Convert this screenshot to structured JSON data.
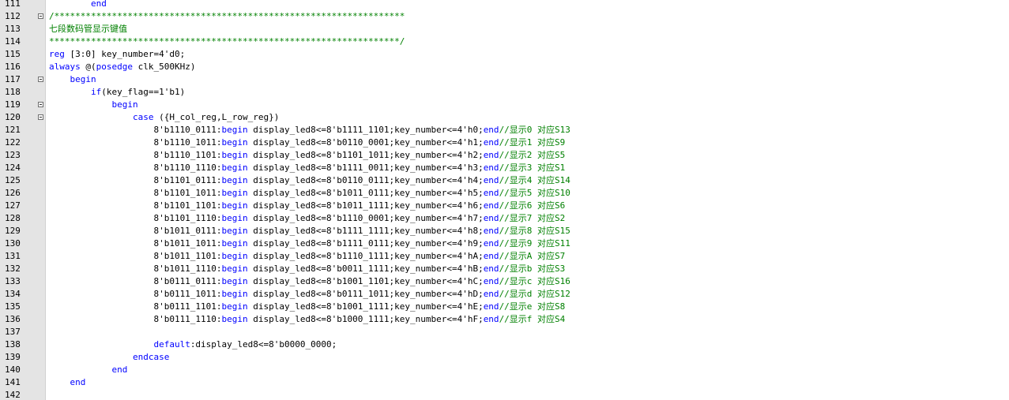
{
  "editor": {
    "lines": [
      {
        "num": "111",
        "fold": false,
        "tokens": [
          {
            "t": "        ",
            "c": ""
          },
          {
            "t": "end",
            "c": "kw"
          }
        ]
      },
      {
        "num": "112",
        "fold": true,
        "tokens": [
          {
            "t": "/*******************************************************************",
            "c": "cm"
          }
        ]
      },
      {
        "num": "113",
        "fold": false,
        "tokens": [
          {
            "t": "七段数码管显示键值",
            "c": "cm"
          }
        ]
      },
      {
        "num": "114",
        "fold": false,
        "tokens": [
          {
            "t": "*******************************************************************/",
            "c": "cm"
          }
        ]
      },
      {
        "num": "115",
        "fold": false,
        "tokens": [
          {
            "t": "reg",
            "c": "kw"
          },
          {
            "t": " [3:0] key_number=4'd0;",
            "c": ""
          }
        ]
      },
      {
        "num": "116",
        "fold": false,
        "tokens": [
          {
            "t": "always",
            "c": "kw"
          },
          {
            "t": " @(",
            "c": ""
          },
          {
            "t": "posedge",
            "c": "kw"
          },
          {
            "t": " clk_500KHz)",
            "c": ""
          }
        ]
      },
      {
        "num": "117",
        "fold": true,
        "tokens": [
          {
            "t": "    ",
            "c": ""
          },
          {
            "t": "begin",
            "c": "kw"
          }
        ]
      },
      {
        "num": "118",
        "fold": false,
        "tokens": [
          {
            "t": "        ",
            "c": ""
          },
          {
            "t": "if",
            "c": "kw"
          },
          {
            "t": "(key_flag==1'b1)",
            "c": ""
          }
        ]
      },
      {
        "num": "119",
        "fold": true,
        "tokens": [
          {
            "t": "            ",
            "c": ""
          },
          {
            "t": "begin",
            "c": "kw"
          }
        ]
      },
      {
        "num": "120",
        "fold": true,
        "tokens": [
          {
            "t": "                ",
            "c": ""
          },
          {
            "t": "case",
            "c": "kw"
          },
          {
            "t": " ({H_col_reg,L_row_reg})",
            "c": ""
          }
        ]
      },
      {
        "num": "121",
        "fold": false,
        "tokens": [
          {
            "t": "                    8'b1110_0111:",
            "c": ""
          },
          {
            "t": "begin",
            "c": "kw"
          },
          {
            "t": " display_led8<=8'b1111_1101;key_number<=4'h0;",
            "c": ""
          },
          {
            "t": "end",
            "c": "kw"
          },
          {
            "t": "//显示0 对应S13",
            "c": "cm"
          }
        ]
      },
      {
        "num": "122",
        "fold": false,
        "tokens": [
          {
            "t": "                    8'b1110_1011:",
            "c": ""
          },
          {
            "t": "begin",
            "c": "kw"
          },
          {
            "t": " display_led8<=8'b0110_0001;key_number<=4'h1;",
            "c": ""
          },
          {
            "t": "end",
            "c": "kw"
          },
          {
            "t": "//显示1 对应S9",
            "c": "cm"
          }
        ]
      },
      {
        "num": "123",
        "fold": false,
        "tokens": [
          {
            "t": "                    8'b1110_1101:",
            "c": ""
          },
          {
            "t": "begin",
            "c": "kw"
          },
          {
            "t": " display_led8<=8'b1101_1011;key_number<=4'h2;",
            "c": ""
          },
          {
            "t": "end",
            "c": "kw"
          },
          {
            "t": "//显示2 对应S5",
            "c": "cm"
          }
        ]
      },
      {
        "num": "124",
        "fold": false,
        "tokens": [
          {
            "t": "                    8'b1110_1110:",
            "c": ""
          },
          {
            "t": "begin",
            "c": "kw"
          },
          {
            "t": " display_led8<=8'b1111_0011;key_number<=4'h3;",
            "c": ""
          },
          {
            "t": "end",
            "c": "kw"
          },
          {
            "t": "//显示3 对应S1",
            "c": "cm"
          }
        ]
      },
      {
        "num": "125",
        "fold": false,
        "tokens": [
          {
            "t": "                    8'b1101_0111:",
            "c": ""
          },
          {
            "t": "begin",
            "c": "kw"
          },
          {
            "t": " display_led8<=8'b0110_0111;key_number<=4'h4;",
            "c": ""
          },
          {
            "t": "end",
            "c": "kw"
          },
          {
            "t": "//显示4 对应S14",
            "c": "cm"
          }
        ]
      },
      {
        "num": "126",
        "fold": false,
        "tokens": [
          {
            "t": "                    8'b1101_1011:",
            "c": ""
          },
          {
            "t": "begin",
            "c": "kw"
          },
          {
            "t": " display_led8<=8'b1011_0111;key_number<=4'h5;",
            "c": ""
          },
          {
            "t": "end",
            "c": "kw"
          },
          {
            "t": "//显示5 对应S10",
            "c": "cm"
          }
        ]
      },
      {
        "num": "127",
        "fold": false,
        "tokens": [
          {
            "t": "                    8'b1101_1101:",
            "c": ""
          },
          {
            "t": "begin",
            "c": "kw"
          },
          {
            "t": " display_led8<=8'b1011_1111;key_number<=4'h6;",
            "c": ""
          },
          {
            "t": "end",
            "c": "kw"
          },
          {
            "t": "//显示6 对应S6",
            "c": "cm"
          }
        ]
      },
      {
        "num": "128",
        "fold": false,
        "tokens": [
          {
            "t": "                    8'b1101_1110:",
            "c": ""
          },
          {
            "t": "begin",
            "c": "kw"
          },
          {
            "t": " display_led8<=8'b1110_0001;key_number<=4'h7;",
            "c": ""
          },
          {
            "t": "end",
            "c": "kw"
          },
          {
            "t": "//显示7 对应S2",
            "c": "cm"
          }
        ]
      },
      {
        "num": "129",
        "fold": false,
        "tokens": [
          {
            "t": "                    8'b1011_0111:",
            "c": ""
          },
          {
            "t": "begin",
            "c": "kw"
          },
          {
            "t": " display_led8<=8'b1111_1111;key_number<=4'h8;",
            "c": ""
          },
          {
            "t": "end",
            "c": "kw"
          },
          {
            "t": "//显示8 对应S15",
            "c": "cm"
          }
        ]
      },
      {
        "num": "130",
        "fold": false,
        "tokens": [
          {
            "t": "                    8'b1011_1011:",
            "c": ""
          },
          {
            "t": "begin",
            "c": "kw"
          },
          {
            "t": " display_led8<=8'b1111_0111;key_number<=4'h9;",
            "c": ""
          },
          {
            "t": "end",
            "c": "kw"
          },
          {
            "t": "//显示9 对应S11",
            "c": "cm"
          }
        ]
      },
      {
        "num": "131",
        "fold": false,
        "tokens": [
          {
            "t": "                    8'b1011_1101:",
            "c": ""
          },
          {
            "t": "begin",
            "c": "kw"
          },
          {
            "t": " display_led8<=8'b1110_1111;key_number<=4'hA;",
            "c": ""
          },
          {
            "t": "end",
            "c": "kw"
          },
          {
            "t": "//显示A 对应S7",
            "c": "cm"
          }
        ]
      },
      {
        "num": "132",
        "fold": false,
        "tokens": [
          {
            "t": "                    8'b1011_1110:",
            "c": ""
          },
          {
            "t": "begin",
            "c": "kw"
          },
          {
            "t": " display_led8<=8'b0011_1111;key_number<=4'hB;",
            "c": ""
          },
          {
            "t": "end",
            "c": "kw"
          },
          {
            "t": "//显示b 对应S3",
            "c": "cm"
          }
        ]
      },
      {
        "num": "133",
        "fold": false,
        "tokens": [
          {
            "t": "                    8'b0111_0111:",
            "c": ""
          },
          {
            "t": "begin",
            "c": "kw"
          },
          {
            "t": " display_led8<=8'b1001_1101;key_number<=4'hC;",
            "c": ""
          },
          {
            "t": "end",
            "c": "kw"
          },
          {
            "t": "//显示c 对应S16",
            "c": "cm"
          }
        ]
      },
      {
        "num": "134",
        "fold": false,
        "tokens": [
          {
            "t": "                    8'b0111_1011:",
            "c": ""
          },
          {
            "t": "begin",
            "c": "kw"
          },
          {
            "t": " display_led8<=8'b0111_1011;key_number<=4'hD;",
            "c": ""
          },
          {
            "t": "end",
            "c": "kw"
          },
          {
            "t": "//显示d 对应S12",
            "c": "cm"
          }
        ]
      },
      {
        "num": "135",
        "fold": false,
        "tokens": [
          {
            "t": "                    8'b0111_1101:",
            "c": ""
          },
          {
            "t": "begin",
            "c": "kw"
          },
          {
            "t": " display_led8<=8'b1001_1111;key_number<=4'hE;",
            "c": ""
          },
          {
            "t": "end",
            "c": "kw"
          },
          {
            "t": "//显示e 对应S8",
            "c": "cm"
          }
        ]
      },
      {
        "num": "136",
        "fold": false,
        "tokens": [
          {
            "t": "                    8'b0111_1110:",
            "c": ""
          },
          {
            "t": "begin",
            "c": "kw"
          },
          {
            "t": " display_led8<=8'b1000_1111;key_number<=4'hF;",
            "c": ""
          },
          {
            "t": "end",
            "c": "kw"
          },
          {
            "t": "//显示f 对应S4",
            "c": "cm"
          }
        ]
      },
      {
        "num": "137",
        "fold": false,
        "tokens": []
      },
      {
        "num": "138",
        "fold": false,
        "tokens": [
          {
            "t": "                    ",
            "c": ""
          },
          {
            "t": "default",
            "c": "kw"
          },
          {
            "t": ":display_led8<=8'b0000_0000;",
            "c": ""
          }
        ]
      },
      {
        "num": "139",
        "fold": false,
        "tokens": [
          {
            "t": "                ",
            "c": ""
          },
          {
            "t": "endcase",
            "c": "kw"
          }
        ]
      },
      {
        "num": "140",
        "fold": false,
        "tokens": [
          {
            "t": "            ",
            "c": ""
          },
          {
            "t": "end",
            "c": "kw"
          }
        ]
      },
      {
        "num": "141",
        "fold": false,
        "tokens": [
          {
            "t": "    ",
            "c": ""
          },
          {
            "t": "end",
            "c": "kw"
          }
        ]
      },
      {
        "num": "142",
        "fold": false,
        "tokens": []
      }
    ]
  },
  "colors": {
    "keyword": "#0000ff",
    "comment": "#008000",
    "gutter_bg": "#e4e4e4",
    "text": "#000000"
  }
}
